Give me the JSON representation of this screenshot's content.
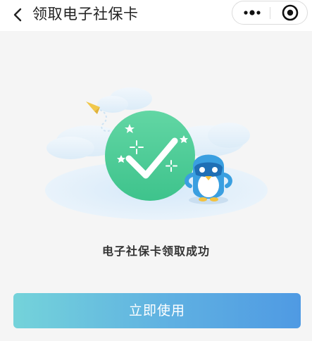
{
  "navbar": {
    "title": "领取电子社保卡",
    "back_icon": "chevron-left-icon",
    "menu_icon": "more-dots-icon",
    "close_icon": "target-close-icon"
  },
  "result": {
    "message": "电子社保卡领取成功",
    "status_icon": "checkmark-icon"
  },
  "actions": {
    "use_now_label": "立即使用"
  },
  "colors": {
    "navbar_bg": "#ffffff",
    "page_bg": "#f5f5f5",
    "success_green": "#4ccf95",
    "button_gradient_start": "#74d3da",
    "button_gradient_end": "#4f9ae3"
  }
}
